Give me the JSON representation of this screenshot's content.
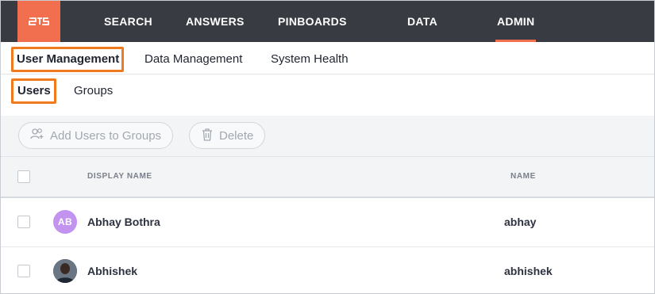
{
  "nav": {
    "items": [
      {
        "label": "SEARCH"
      },
      {
        "label": "ANSWERS"
      },
      {
        "label": "PINBOARDS"
      },
      {
        "label": "DATA"
      },
      {
        "label": "ADMIN",
        "active": true
      }
    ],
    "logo_icon": "thoughtspot-logo-icon"
  },
  "tabs_primary": [
    {
      "label": "User Management",
      "active": true
    },
    {
      "label": "Data Management"
    },
    {
      "label": "System Health"
    }
  ],
  "tabs_secondary": [
    {
      "label": "Users",
      "active": true
    },
    {
      "label": "Groups"
    }
  ],
  "toolbar": {
    "add_to_groups_label": "Add Users to Groups",
    "add_to_groups_icon": "users-add-icon",
    "delete_label": "Delete",
    "delete_icon": "trash-icon"
  },
  "table": {
    "columns": [
      "DISPLAY NAME",
      "NAME"
    ],
    "rows": [
      {
        "display_name": "Abhay Bothra",
        "name": "abhay",
        "avatar_initials": "AB"
      },
      {
        "display_name": "Abhishek",
        "name": "abhishek",
        "avatar_type": "photo"
      }
    ]
  },
  "colors": {
    "nav_bg": "#383b41",
    "accent": "#f16f4e",
    "highlight": "#f07a1e",
    "avatar_initials_bg": "#c294ef"
  }
}
